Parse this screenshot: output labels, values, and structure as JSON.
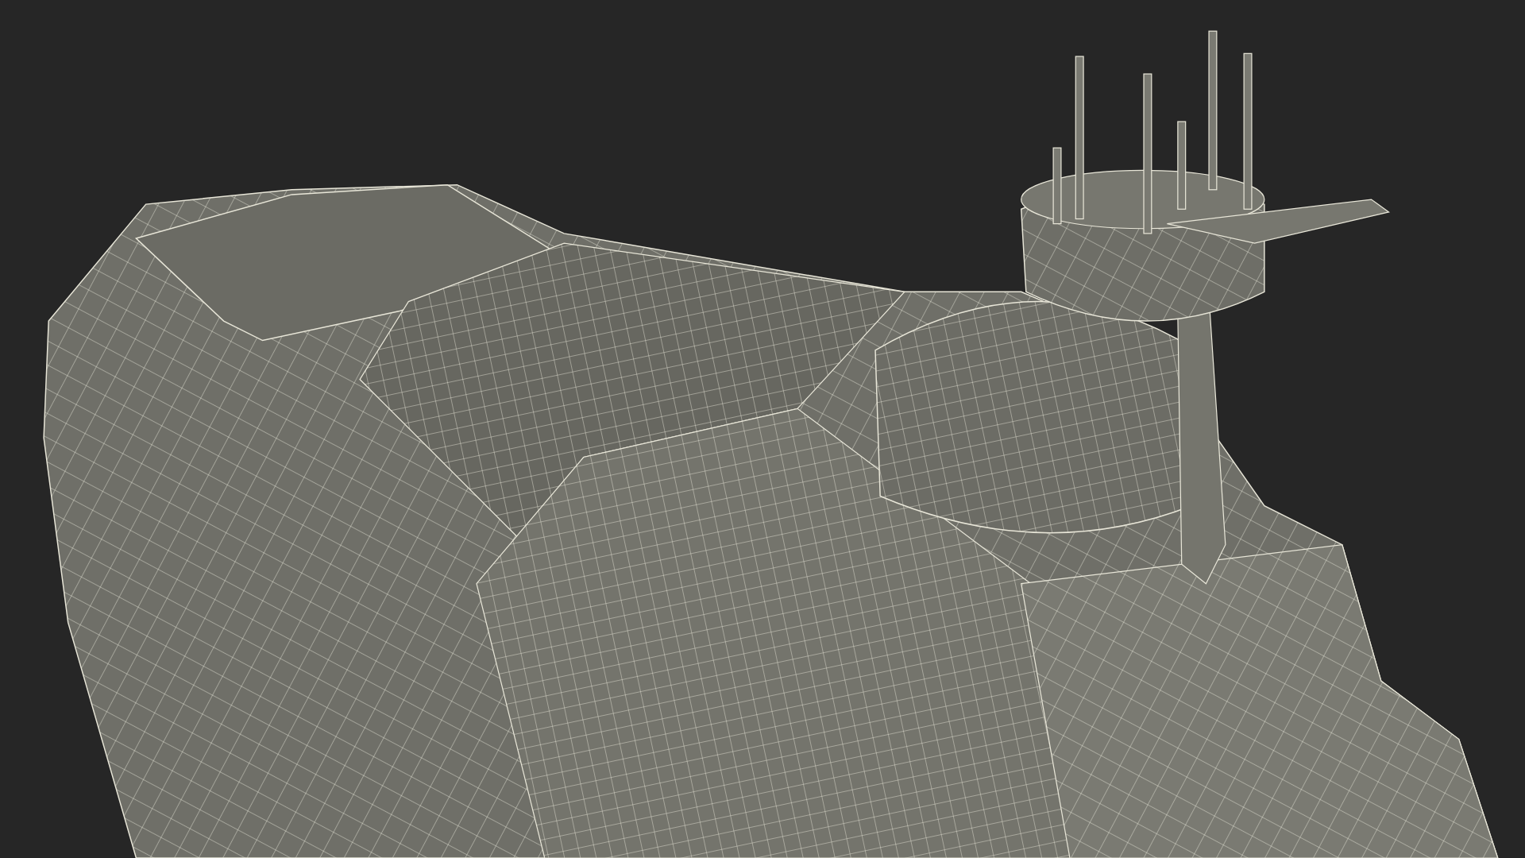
{
  "viewport": {
    "kind": "wireframe"
  }
}
